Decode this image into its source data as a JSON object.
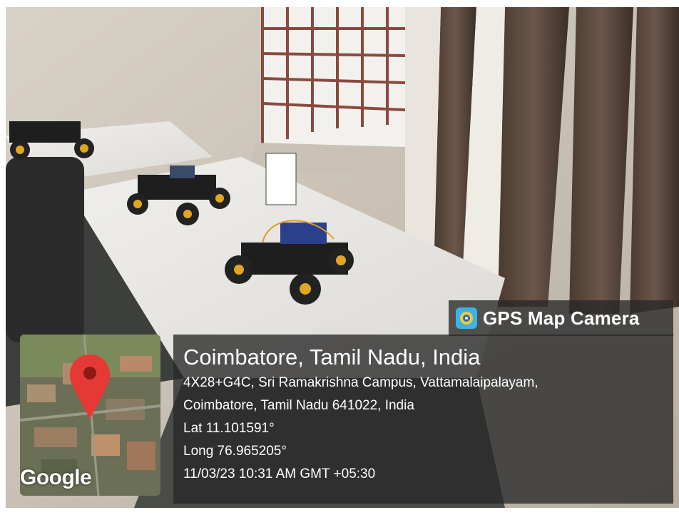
{
  "overlay": {
    "app_name": "GPS Map Camera",
    "app_icon": "gps-map-camera-icon",
    "map_provider": "Google",
    "location_title": "Coimbatore, Tamil Nadu, India",
    "address_line1": "4X28+G4C, Sri Ramakrishna Campus, Vattamalaipalayam,",
    "address_line2": "Coimbatore, Tamil Nadu 641022, India",
    "latitude": "Lat 11.101591°",
    "longitude": "Long 76.965205°",
    "timestamp": "11/03/23 10:31 AM GMT +05:30",
    "pin_color": "#e53935",
    "panel_color": "#282828"
  }
}
